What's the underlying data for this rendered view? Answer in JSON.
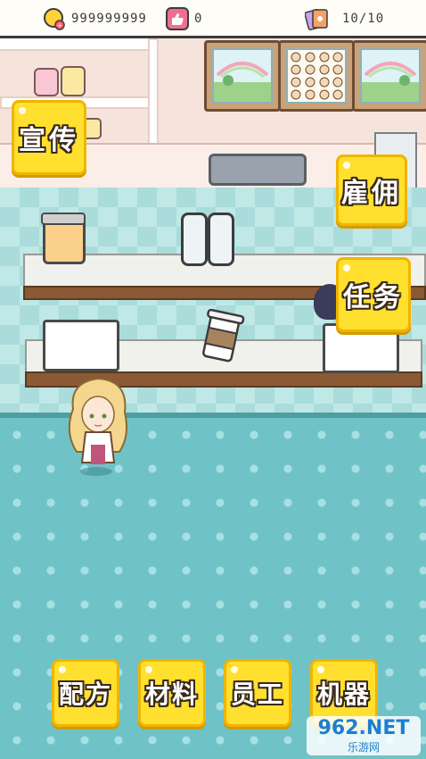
{
  "status_bar": {
    "coins": "999999999",
    "likes": "0",
    "tickets": "10/10"
  },
  "buttons": {
    "promote": "宣传",
    "hire": "雇佣",
    "tasks": "任务",
    "recipes": "配方",
    "materials": "材料",
    "staff": "员工",
    "machines": "机器"
  },
  "watermark": {
    "main": "962.NET",
    "sub": "乐游网"
  },
  "colors": {
    "button_yellow": "#ffe02e",
    "floor_teal": "#6fc3c7"
  }
}
